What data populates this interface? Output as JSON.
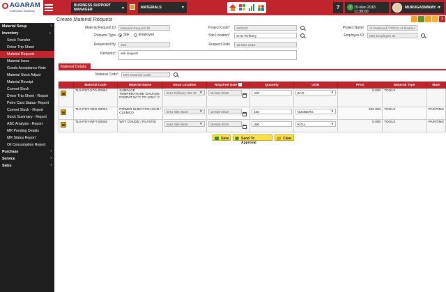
{
  "header": {
    "logo_name": "AGARAM",
    "logo_tagline": "Enterprise Solutions",
    "module_line1": "BUSINESS SUPPORT",
    "module_line2": "MANAGER",
    "context": "MATERIALS",
    "help": "?",
    "datetime": "15-Mar-2018 11:39:00",
    "user": "MURUGASWAMY -",
    "accent": "#c0242c",
    "icons": [
      "home-icon",
      "grid-icon",
      "chart-icon",
      "users-icon"
    ]
  },
  "sidebar": {
    "items": [
      {
        "label": "Material Setup",
        "level": "top",
        "arrow": "›"
      },
      {
        "label": "Inventory",
        "level": "top",
        "arrow": "⌄"
      },
      {
        "label": "Stock Transfer",
        "level": "sub"
      },
      {
        "label": "Driver Trip Sheet",
        "level": "sub"
      },
      {
        "label": "Material Request",
        "level": "sub",
        "active": true
      },
      {
        "label": "Material Issue",
        "level": "sub"
      },
      {
        "label": "Goods Acceptance Note",
        "level": "sub"
      },
      {
        "label": "Material Stock Adjust",
        "level": "sub"
      },
      {
        "label": "Material Receipt",
        "level": "sub"
      },
      {
        "label": "Current Stock",
        "level": "sub"
      },
      {
        "label": "Driver Trip Sheet - Report",
        "level": "sub"
      },
      {
        "label": "Petro Card Status- Report",
        "level": "sub"
      },
      {
        "label": "Current Stock - Report",
        "level": "sub"
      },
      {
        "label": "Stock Summary - Report",
        "level": "sub"
      },
      {
        "label": "ABC Analysis - Report",
        "level": "sub"
      },
      {
        "label": "MR Pending Details",
        "level": "sub"
      },
      {
        "label": "MR Status Report",
        "level": "sub"
      },
      {
        "label": "Oil Consumption Report",
        "level": "sub"
      },
      {
        "label": "Purchase",
        "level": "top",
        "arrow": "›"
      },
      {
        "label": "Service",
        "level": "top",
        "arrow": "›"
      },
      {
        "label": "Sales",
        "level": "top",
        "arrow": "›"
      }
    ]
  },
  "page": {
    "title": "Create Material Request",
    "close": "×"
  },
  "form": {
    "material_request_id_label": "Material Request ID",
    "material_request_id_placeholder": "Material Request ID",
    "project_code_label": "Project Code*",
    "project_code_value": "12034D",
    "project_name_label": "Project Name",
    "project_name_value": "Al-Rasheed / PROU Al-Rasher",
    "request_type_label": "Request Type",
    "request_type_options": [
      "Site",
      "Employee"
    ],
    "site_location_label": "Site Location*",
    "site_location_value": "SHU Refinery",
    "employee_id_label": "Employee ID",
    "employee_id_placeholder": "MIS Employee ID",
    "requested_by_label": "Requested By",
    "requested_by_value": "205",
    "request_date_label": "Request Date",
    "request_date_value": "15-Mar-2018",
    "remarks_label": "Remarks*",
    "remarks_value": "site request"
  },
  "details": {
    "tab_label": "Material Details",
    "material_code_label": "Material Code*",
    "material_code_placeholder": "MIS Material Code",
    "columns": [
      "",
      "Material Code",
      "Material Name",
      "Issue Location",
      "Required Date",
      "Quantity",
      "UOM",
      "Price",
      "Material Type",
      "Mate"
    ],
    "rows": [
      {
        "code": "TLS-PNT-STG-00004",
        "name": "SURFACE TEMPERATURE GAUAGE FOSPAT 0A°C TO 120A° C",
        "location": "SHU Refinery Site St",
        "date": "15-Mar-2018",
        "qty": "200",
        "uom": "BAG",
        "price": "0.000",
        "type": "TOOLS",
        "mate": ""
      },
      {
        "code": "TLS-PNT-VBG-00001",
        "name": "POWER INJECTION GUN / CLEMCO",
        "location": "SHU Site Store",
        "date": "15-Mar-2018",
        "qty": "150",
        "uom": "NUMBERS",
        "price": "250.000",
        "type": "TOOLS",
        "mate": "PAINTING"
      },
      {
        "code": "TLS-PNT-WFT-00002",
        "name": "WFT GAUGE / PLASTIC",
        "location": "SHU Site Store",
        "date": "15-Mar-2018",
        "qty": "300",
        "uom": "ROLL",
        "price": "0.000",
        "type": "TOOLS",
        "mate": "PAINTING"
      }
    ]
  },
  "actions": {
    "save": "Save",
    "send": "Send To Approval",
    "clear": "Clear"
  }
}
